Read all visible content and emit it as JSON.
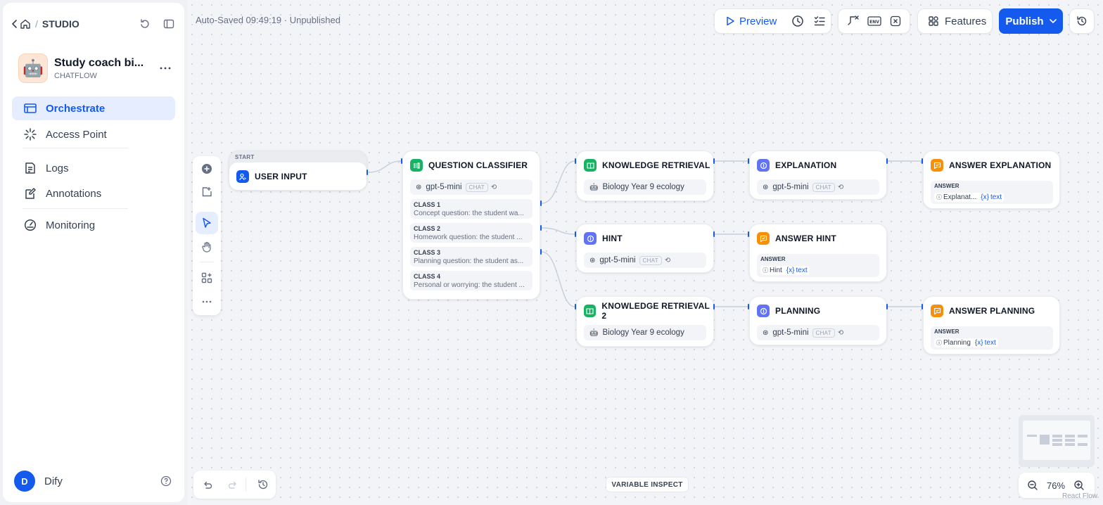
{
  "sidebar": {
    "breadcrumb": "STUDIO",
    "app": {
      "name": "Study coach bi...",
      "type": "CHATFLOW",
      "emoji": "🤖"
    },
    "nav": [
      {
        "label": "Orchestrate",
        "icon": "workflow-icon",
        "active": true
      },
      {
        "label": "Access Point",
        "icon": "access-point-icon",
        "active": false
      },
      {
        "label": "Logs",
        "icon": "logs-icon",
        "active": false
      },
      {
        "label": "Annotations",
        "icon": "annotations-icon",
        "active": false
      },
      {
        "label": "Monitoring",
        "icon": "monitoring-icon",
        "active": false
      }
    ],
    "user": {
      "initial": "D",
      "name": "Dify"
    }
  },
  "header": {
    "status": "Auto-Saved 09:49:19 · Unpublished",
    "preview_label": "Preview",
    "features_label": "Features",
    "publish_label": "Publish"
  },
  "nodes": {
    "start": {
      "label": "START",
      "title": "USER INPUT"
    },
    "classifier": {
      "title": "QUESTION CLASSIFIER",
      "model": "gpt-5-mini",
      "model_tag": "CHAT",
      "classes": [
        {
          "name": "CLASS 1",
          "desc": "Concept question: the student wa..."
        },
        {
          "name": "CLASS 2",
          "desc": "Homework question: the student ..."
        },
        {
          "name": "CLASS 3",
          "desc": "Planning question: the student as..."
        },
        {
          "name": "CLASS 4",
          "desc": "Personal or worrying: the student ..."
        }
      ]
    },
    "kr1": {
      "title": "KNOWLEDGE RETRIEVAL",
      "dataset": "Biology Year 9 ecology"
    },
    "hint": {
      "title": "HINT",
      "model": "gpt-5-mini",
      "model_tag": "CHAT"
    },
    "kr2": {
      "title": "KNOWLEDGE RETRIEVAL 2",
      "dataset": "Biology Year 9 ecology"
    },
    "explanation": {
      "title": "EXPLANATION",
      "model": "gpt-5-mini",
      "model_tag": "CHAT"
    },
    "answer_hint": {
      "title": "ANSWER HINT",
      "section": "ANSWER",
      "var": "Hint",
      "field": "text"
    },
    "planning": {
      "title": "PLANNING",
      "model": "gpt-5-mini",
      "model_tag": "CHAT"
    },
    "answer_explanation": {
      "title": "ANSWER EXPLANATION",
      "section": "ANSWER",
      "var": "Explanat...",
      "field": "text"
    },
    "answer_planning": {
      "title": "ANSWER PLANNING",
      "section": "ANSWER",
      "var": "Planning",
      "field": "text"
    }
  },
  "footer": {
    "variable_inspect": "VARIABLE INSPECT",
    "zoom": "76%",
    "watermark": "React Flow"
  },
  "colors": {
    "accent": "#155aef",
    "green": "#16b364",
    "indigo": "#6172f3",
    "orange": "#f79009",
    "blue": "#1570ef"
  }
}
